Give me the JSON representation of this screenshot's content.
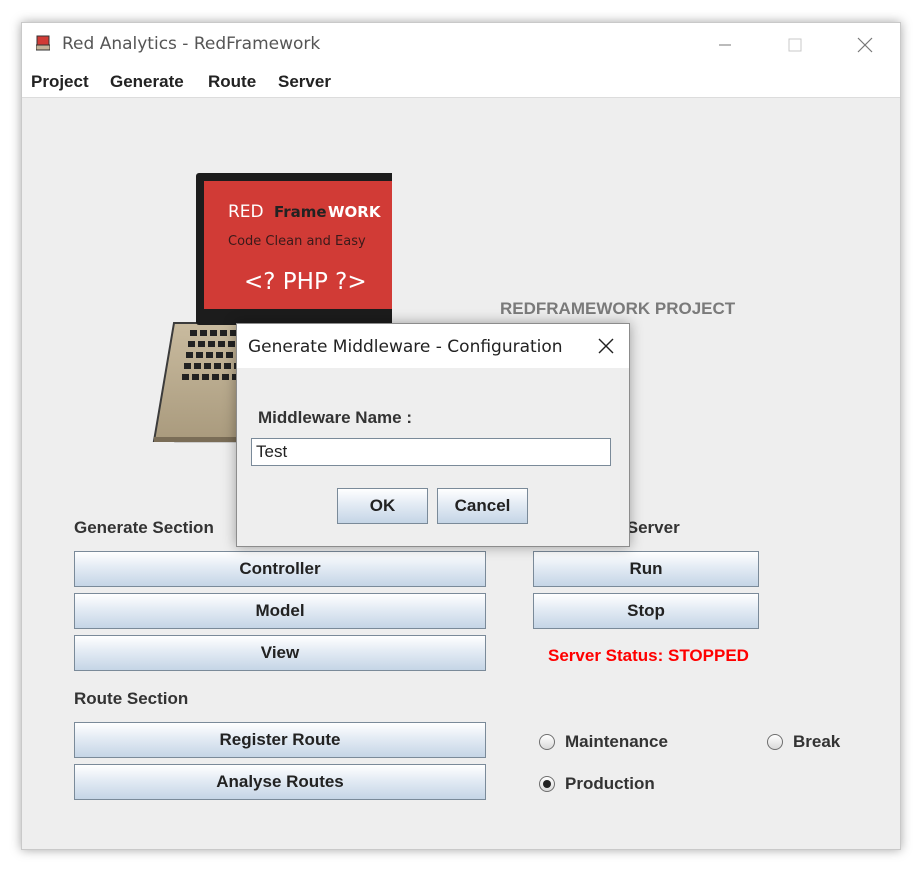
{
  "window": {
    "title": "Red Analytics - RedFramework"
  },
  "menu": [
    "Project",
    "Generate",
    "Route",
    "Server"
  ],
  "logo": {
    "line1_a": "RED",
    "line1_b": "Frame",
    "line1_c": "WORK",
    "line2": "Code Clean and Easy",
    "line3": "<? PHP ?>"
  },
  "project_label": "REDFRAMEWORK PROJECT",
  "generate_section": {
    "heading": "Generate Section",
    "buttons": [
      "Controller",
      "Model",
      "View"
    ]
  },
  "route_section": {
    "heading": "Route Section",
    "buttons": [
      "Register Route",
      "Analyse Routes"
    ]
  },
  "server_section": {
    "heading_visible": "nt Server",
    "buttons": [
      "Run",
      "Stop"
    ],
    "status": "Server Status: STOPPED"
  },
  "modes": {
    "options": [
      "Maintenance",
      "Break",
      "Production"
    ],
    "selected": "Production"
  },
  "dialog": {
    "title": "Generate Middleware - Configuration",
    "field_label": "Middleware Name :",
    "field_value": "Test",
    "ok_label": "OK",
    "cancel_label": "Cancel"
  },
  "colors": {
    "status_red": "#ff0000",
    "logo_red": "#d13b36",
    "button_gradient_bottom": "#c5d5e6"
  }
}
